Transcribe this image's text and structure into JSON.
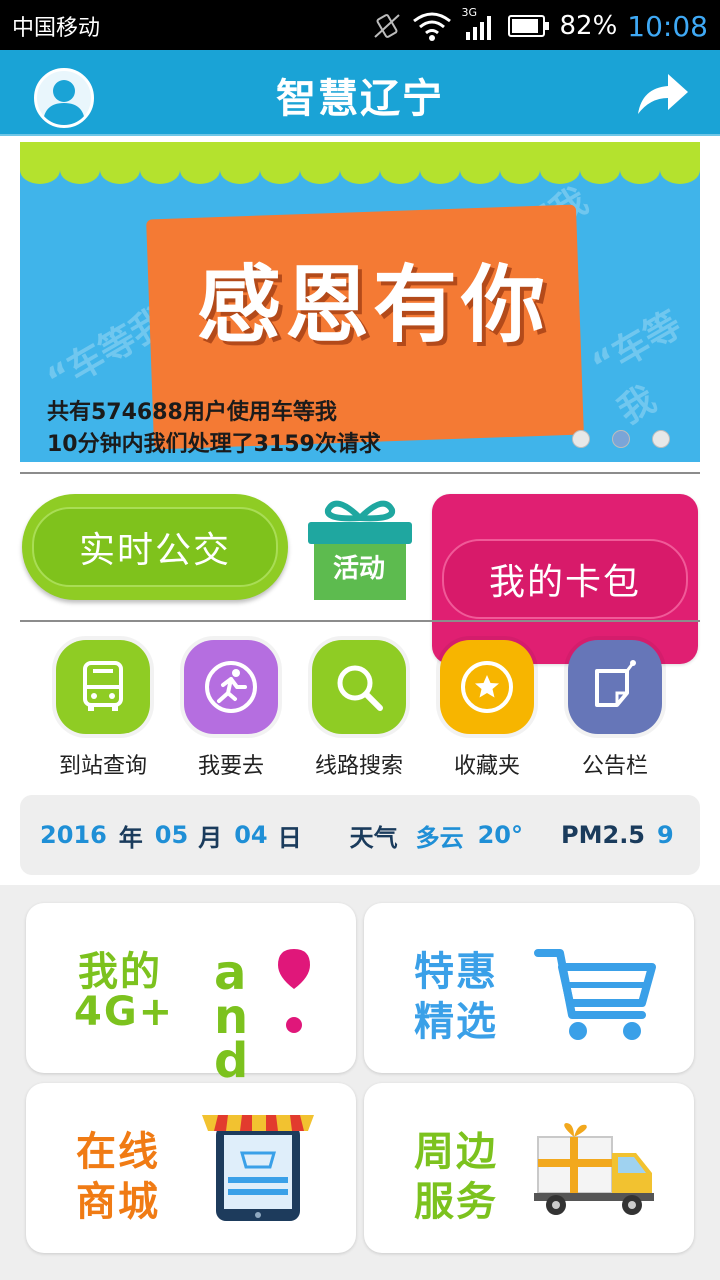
{
  "status_bar": {
    "carrier": "中国移动",
    "network": "3G",
    "battery": "82%",
    "time": "10:08"
  },
  "header": {
    "title": "智慧辽宁"
  },
  "banner": {
    "watermark": "“车等我",
    "headline": "感恩有你",
    "line1": "共有574688用户使用车等我",
    "line2": "10分钟内我们处理了3159次请求",
    "pages": 3,
    "active_page": 2
  },
  "actions": {
    "bus_label": "实时公交",
    "activity_label": "活动",
    "wallet_label": "我的卡包"
  },
  "tiles": [
    {
      "label": "到站查询",
      "icon": "bus-icon",
      "color": "#8fcc24"
    },
    {
      "label": "我要去",
      "icon": "runner-icon",
      "color": "#b56ee0"
    },
    {
      "label": "线路搜索",
      "icon": "search-icon",
      "color": "#8fcc24"
    },
    {
      "label": "收藏夹",
      "icon": "star-icon",
      "color": "#f7b500"
    },
    {
      "label": "公告栏",
      "icon": "notice-icon",
      "color": "#6676b8"
    }
  ],
  "info": {
    "year": "2016",
    "year_unit": "年",
    "month": "05",
    "month_unit": "月",
    "day": "04",
    "day_unit": "日",
    "weather_label": "天气",
    "weather": "多云",
    "temp": "20°",
    "pm_label": "PM2.5",
    "pm_value": "9"
  },
  "cards": [
    {
      "line1": "我的",
      "line2": "4G+",
      "logo": "and",
      "color": "#7cc21e"
    },
    {
      "line1": "特惠",
      "line2": "精选",
      "color": "#3aa0e8"
    },
    {
      "line1": "在线",
      "line2": "商城",
      "color": "#f07b14"
    },
    {
      "line1": "周边",
      "line2": "服务",
      "color": "#7cc21e"
    }
  ]
}
